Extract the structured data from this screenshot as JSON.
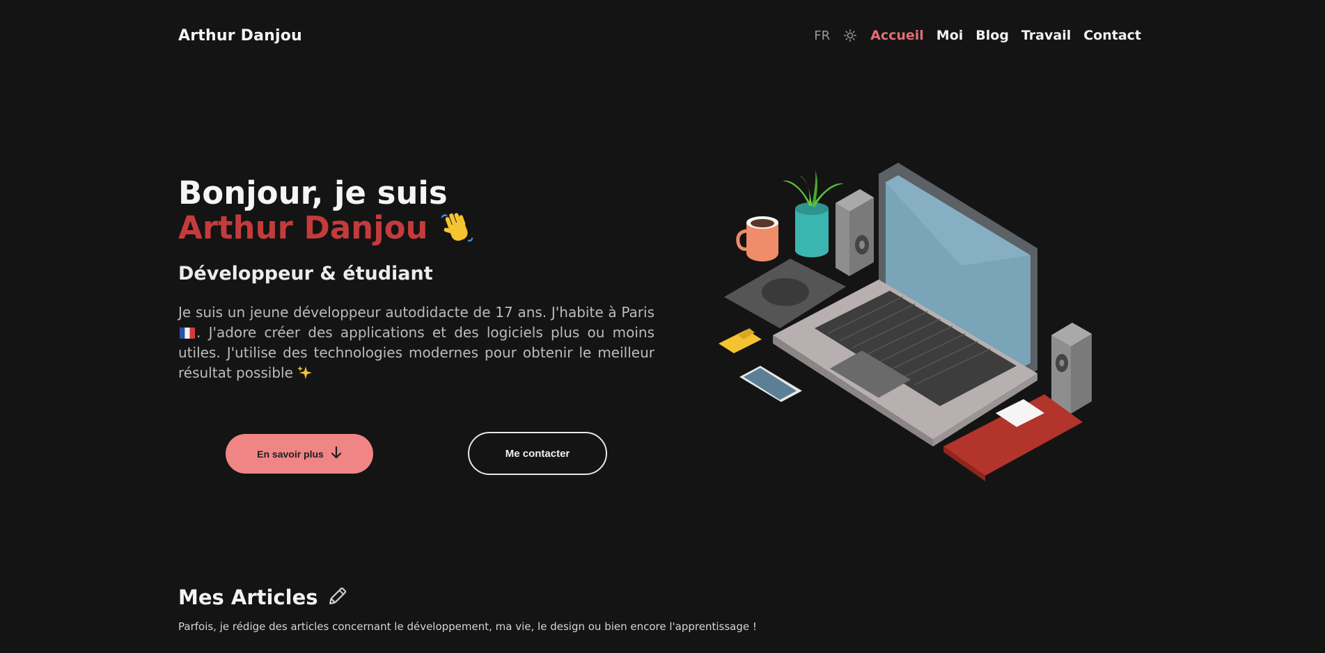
{
  "nav": {
    "brand": "Arthur Danjou",
    "lang": "FR",
    "theme_icon": "sun-icon",
    "links": [
      {
        "label": "Accueil",
        "active": true
      },
      {
        "label": "Moi",
        "active": false
      },
      {
        "label": "Blog",
        "active": false
      },
      {
        "label": "Travail",
        "active": false
      },
      {
        "label": "Contact",
        "active": false
      }
    ]
  },
  "hero": {
    "greeting": "Bonjour, je suis",
    "name": "Arthur Danjou",
    "wave_icon": "waving-hand-icon",
    "subtitle": "Développeur & étudiant",
    "bio_part1": "Je suis un jeune développeur autodidacte de 17 ans. J'habite à Paris",
    "flag_icon": "france-flag-icon",
    "bio_part2": ". J'adore créer des applications et des logiciels plus ou moins utiles. J'utilise des technologies modernes pour obtenir le meilleur résultat possible",
    "sparkle_icon": "sparkles-icon",
    "primary_button": "En savoir plus",
    "primary_button_icon": "arrow-down-icon",
    "secondary_button": "Me contacter"
  },
  "articles": {
    "title": "Mes Articles",
    "title_icon": "pencil-icon",
    "description": "Parfois, je rédige des articles concernant le développement, ma vie, le design ou bien encore l'apprentissage !"
  },
  "colors": {
    "background": "#141414",
    "accent": "#c43b3b",
    "nav_active": "#e06f74",
    "button_primary": "#f08585"
  }
}
